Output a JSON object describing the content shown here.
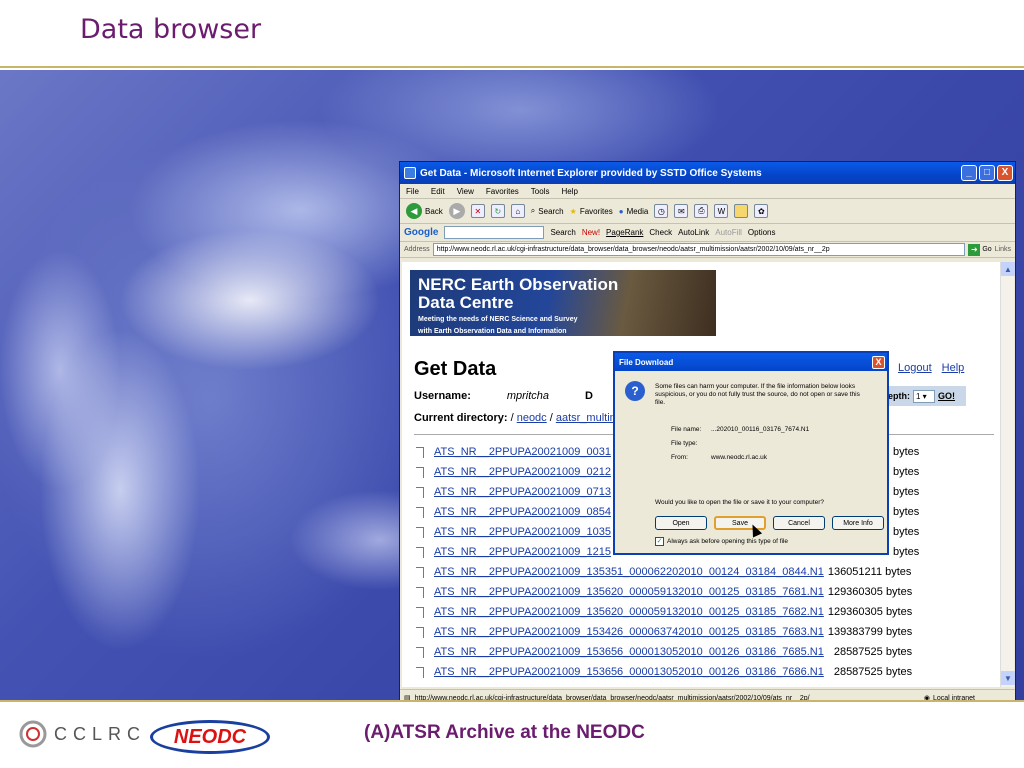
{
  "slide": {
    "title": "Data browser",
    "caption": "(A)ATSR Archive at the NEODC",
    "logo_cclrc": "CCLRC",
    "logo_neodc": "NEODC"
  },
  "window": {
    "title": "Get Data - Microsoft Internet Explorer provided by SSTD Office Systems",
    "min": "_",
    "max": "□",
    "close": "X"
  },
  "menu": [
    "File",
    "Edit",
    "View",
    "Favorites",
    "Tools",
    "Help"
  ],
  "toolbar": {
    "back": "Back",
    "search": "Search",
    "favorites": "Favorites",
    "media": "Media"
  },
  "google": {
    "logo": "Google",
    "search": "Search",
    "new": "New!",
    "pagerank": "PageRank",
    "check": "Check",
    "autolink": "AutoLink",
    "autofill": "AutoFill",
    "options": "Options"
  },
  "address": {
    "label": "Address",
    "url": "http://www.neodc.rl.ac.uk/cgi-infrastructure/data_browser/data_browser/neodc/aatsr_multimission/aatsr/2002/10/09/ats_nr__2p",
    "go": "Go",
    "links": "Links"
  },
  "banner": {
    "title1": "NERC Earth Observation",
    "title2": "Data Centre",
    "sub1": "Meeting the needs of NERC Science and Survey",
    "sub2": "with Earth Observation Data and Information"
  },
  "page": {
    "heading": "Get Data",
    "logout": "Logout",
    "help": "Help",
    "username_label": "Username:",
    "username": "mpritcha",
    "d_label": "D",
    "depth_label": "epth:",
    "depth_value": "1",
    "go": "GO!",
    "curdir_label": "Current directory:",
    "curdir_sep": " / ",
    "curdir_1": "neodc",
    "curdir_2": "aatsr_multim"
  },
  "files": [
    {
      "name": "ATS_NR__2PPUPA20021009_0031",
      "size": "bytes"
    },
    {
      "name": "ATS_NR__2PPUPA20021009_0212",
      "size": "bytes"
    },
    {
      "name": "ATS_NR__2PPUPA20021009_0713",
      "size": "bytes"
    },
    {
      "name": "ATS_NR__2PPUPA20021009_0854",
      "size": "bytes"
    },
    {
      "name": "ATS_NR__2PPUPA20021009_1035",
      "size": "bytes"
    },
    {
      "name": "ATS_NR__2PPUPA20021009_1215",
      "size": "bytes"
    },
    {
      "name": "ATS_NR__2PPUPA20021009_135351_000062202010_00124_03184_0844.N1",
      "size": "136051211 bytes"
    },
    {
      "name": "ATS_NR__2PPUPA20021009_135620_000059132010_00125_03185_7681.N1",
      "size": "129360305 bytes"
    },
    {
      "name": "ATS_NR__2PPUPA20021009_135620_000059132010_00125_03185_7682.N1",
      "size": "129360305 bytes"
    },
    {
      "name": "ATS_NR__2PPUPA20021009_153426_000063742010_00125_03185_7683.N1",
      "size": "139383799 bytes"
    },
    {
      "name": "ATS_NR__2PPUPA20021009_153656_000013052010_00126_03186_7685.N1",
      "size": "28587525 bytes"
    },
    {
      "name": "ATS_NR__2PPUPA20021009_153656_000013052010_00126_03186_7686.N1",
      "size": "28587525 bytes"
    }
  ],
  "status": {
    "url": "http://www.neodc.rl.ac.uk/cgi-infrastructure/data_browser/data_browser/neodc/aatsr_multimission/aatsr/2002/10/09/ats_nr__2p/",
    "zone": "Local intranet"
  },
  "dialog": {
    "title": "File Download",
    "close": "X",
    "warning": "Some files can harm your computer. If the file information below looks suspicious, or you do not fully trust the source, do not open or save this file.",
    "file_name_label": "File name:",
    "file_name": "...202010_00116_03176_7674.N1",
    "file_type_label": "File type:",
    "file_type": "",
    "from_label": "From:",
    "from": "www.neodc.rl.ac.uk",
    "question": "Would you like to open the file or save it to your computer?",
    "open": "Open",
    "save": "Save",
    "cancel": "Cancel",
    "more_info": "More Info",
    "always_ask": "Always ask before opening this type of file"
  }
}
